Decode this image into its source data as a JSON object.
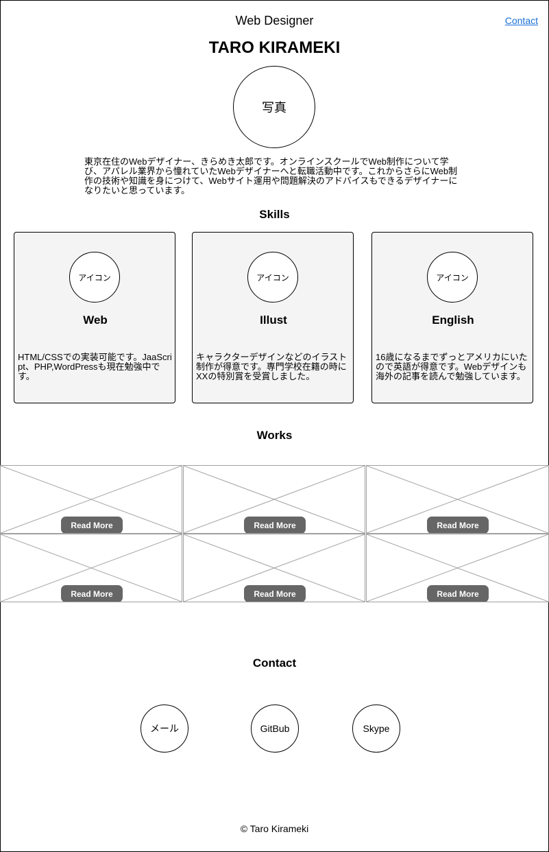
{
  "header": {
    "subtitle": "Web Designer",
    "contact_link": "Contact",
    "name": "TARO KIRAMEKI",
    "photo_label": "写真",
    "intro": "東京在住のWebデザイナー、きらめき太郎です。オンラインスクールでWeb制作について学び、アパレル業界から憧れていたWebデザイナーへと転職活動中です。これからさらにWeb制作の技術や知識を身につけて、Webサイト運用や問題解決のアドバイスもできるデザイナーになりたいと思っています。"
  },
  "skills": {
    "title": "Skills",
    "items": [
      {
        "icon_label": "アイコン",
        "title": "Web",
        "text": "HTML/CSSでの実装可能です。JaaScript、PHP,WordPressも現在勉強中です。"
      },
      {
        "icon_label": "アイコン",
        "title": "Illust",
        "text": "キャラクターデザインなどのイラスト制作が得意です。専門学校在籍の時にXXの特別賞を受賞しました。"
      },
      {
        "icon_label": "アイコン",
        "title": "English",
        "text": "16歳になるまでずっとアメリカにいたので英語が得意です。Webデザインも海外の記事を読んで勉強しています。"
      }
    ]
  },
  "works": {
    "title": "Works",
    "items": [
      {
        "button_label": "Read More"
      },
      {
        "button_label": "Read More"
      },
      {
        "button_label": "Read More"
      },
      {
        "button_label": "Read More"
      },
      {
        "button_label": "Read More"
      },
      {
        "button_label": "Read More"
      }
    ]
  },
  "contact": {
    "title": "Contact",
    "items": [
      {
        "label": "メール"
      },
      {
        "label": "GitBub"
      },
      {
        "label": "Skype"
      }
    ]
  },
  "footer": {
    "copyright": "© Taro Kirameki"
  },
  "colors": {
    "link": "#1a6fd6",
    "button": "#666666",
    "card_bg": "#f4f4f4"
  }
}
